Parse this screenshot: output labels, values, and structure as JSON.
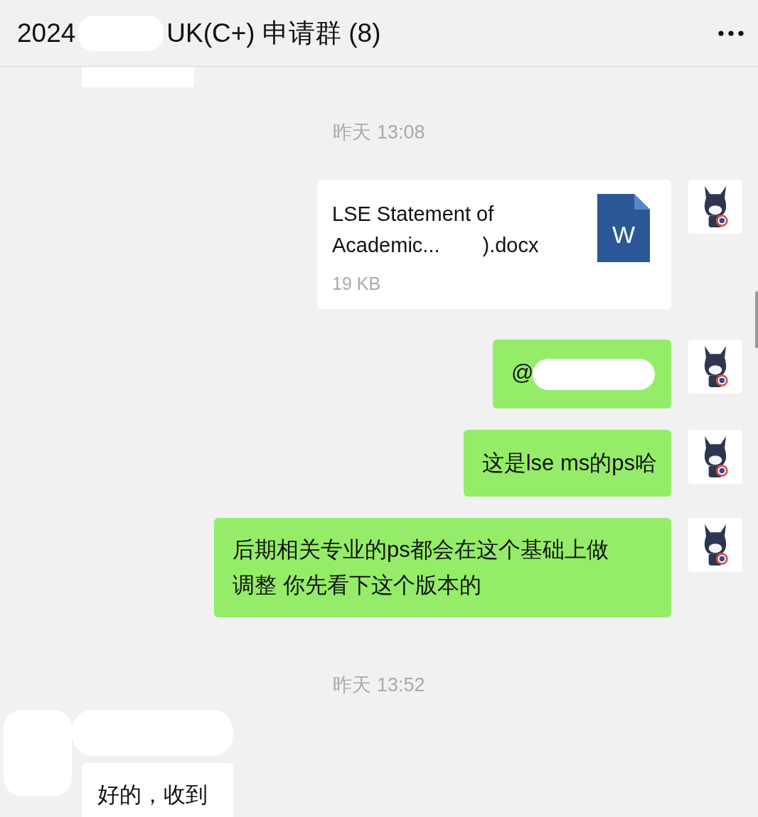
{
  "header": {
    "title_start": "2024",
    "title_end": "UK(C+) 申请群 (8)",
    "title_redacted": true
  },
  "messages": [
    {
      "kind": "fragment"
    },
    {
      "kind": "timestamp",
      "text": "昨天 13:08"
    },
    {
      "kind": "file",
      "outgoing": true,
      "name_line": "LSE Statement of",
      "name_start": "Academic...",
      "name_end": ").docx",
      "size": "19 KB",
      "file_letter": "W"
    },
    {
      "kind": "text",
      "outgoing": true,
      "text": "@",
      "redacted": true
    },
    {
      "kind": "text",
      "outgoing": true,
      "text": "这是lse ms的ps哈",
      "redacted": false
    },
    {
      "kind": "text",
      "outgoing": true,
      "text": "后期相关专业的ps都会在这个基础上做调整 你先看下这个版本的",
      "redacted": false
    },
    {
      "kind": "timestamp",
      "text": "昨天 13:52"
    },
    {
      "kind": "text",
      "outgoing": false,
      "text": "好的，收到",
      "redacted": false,
      "sender_redacted": true
    }
  ]
}
